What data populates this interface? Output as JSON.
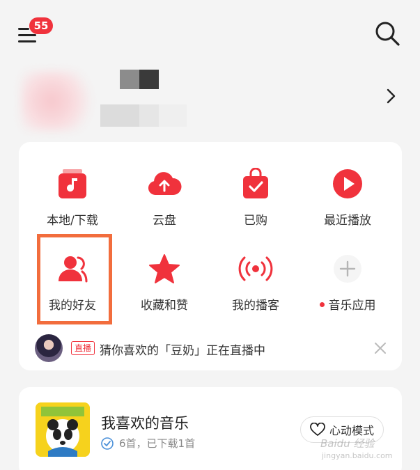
{
  "header": {
    "notification_count": "55",
    "menu_icon": "hamburger-icon",
    "search_icon": "search-icon"
  },
  "profile": {
    "chevron_icon": "chevron-right-icon"
  },
  "quick_access": {
    "items": [
      {
        "label": "本地/下载",
        "icon": "local-download-icon"
      },
      {
        "label": "云盘",
        "icon": "cloud-upload-icon"
      },
      {
        "label": "已购",
        "icon": "purchased-bag-icon"
      },
      {
        "label": "最近播放",
        "icon": "play-icon"
      },
      {
        "label": "我的好友",
        "icon": "friends-icon"
      },
      {
        "label": "收藏和赞",
        "icon": "star-icon"
      },
      {
        "label": "我的播客",
        "icon": "podcast-icon"
      },
      {
        "label": "音乐应用",
        "icon": "plus-icon"
      }
    ],
    "accent_color": "#f0323c",
    "highlight_color": "#f26d3d"
  },
  "live": {
    "tag": "直播",
    "text": "猜你喜欢的「豆奶」正在直播中"
  },
  "favorites": {
    "title": "我喜欢的音乐",
    "subtitle": "6首，已下载1首",
    "heart_mode_label": "心动模式"
  },
  "watermark": {
    "line1": "Baidu 经验",
    "line2": "jingyan.baidu.com"
  }
}
